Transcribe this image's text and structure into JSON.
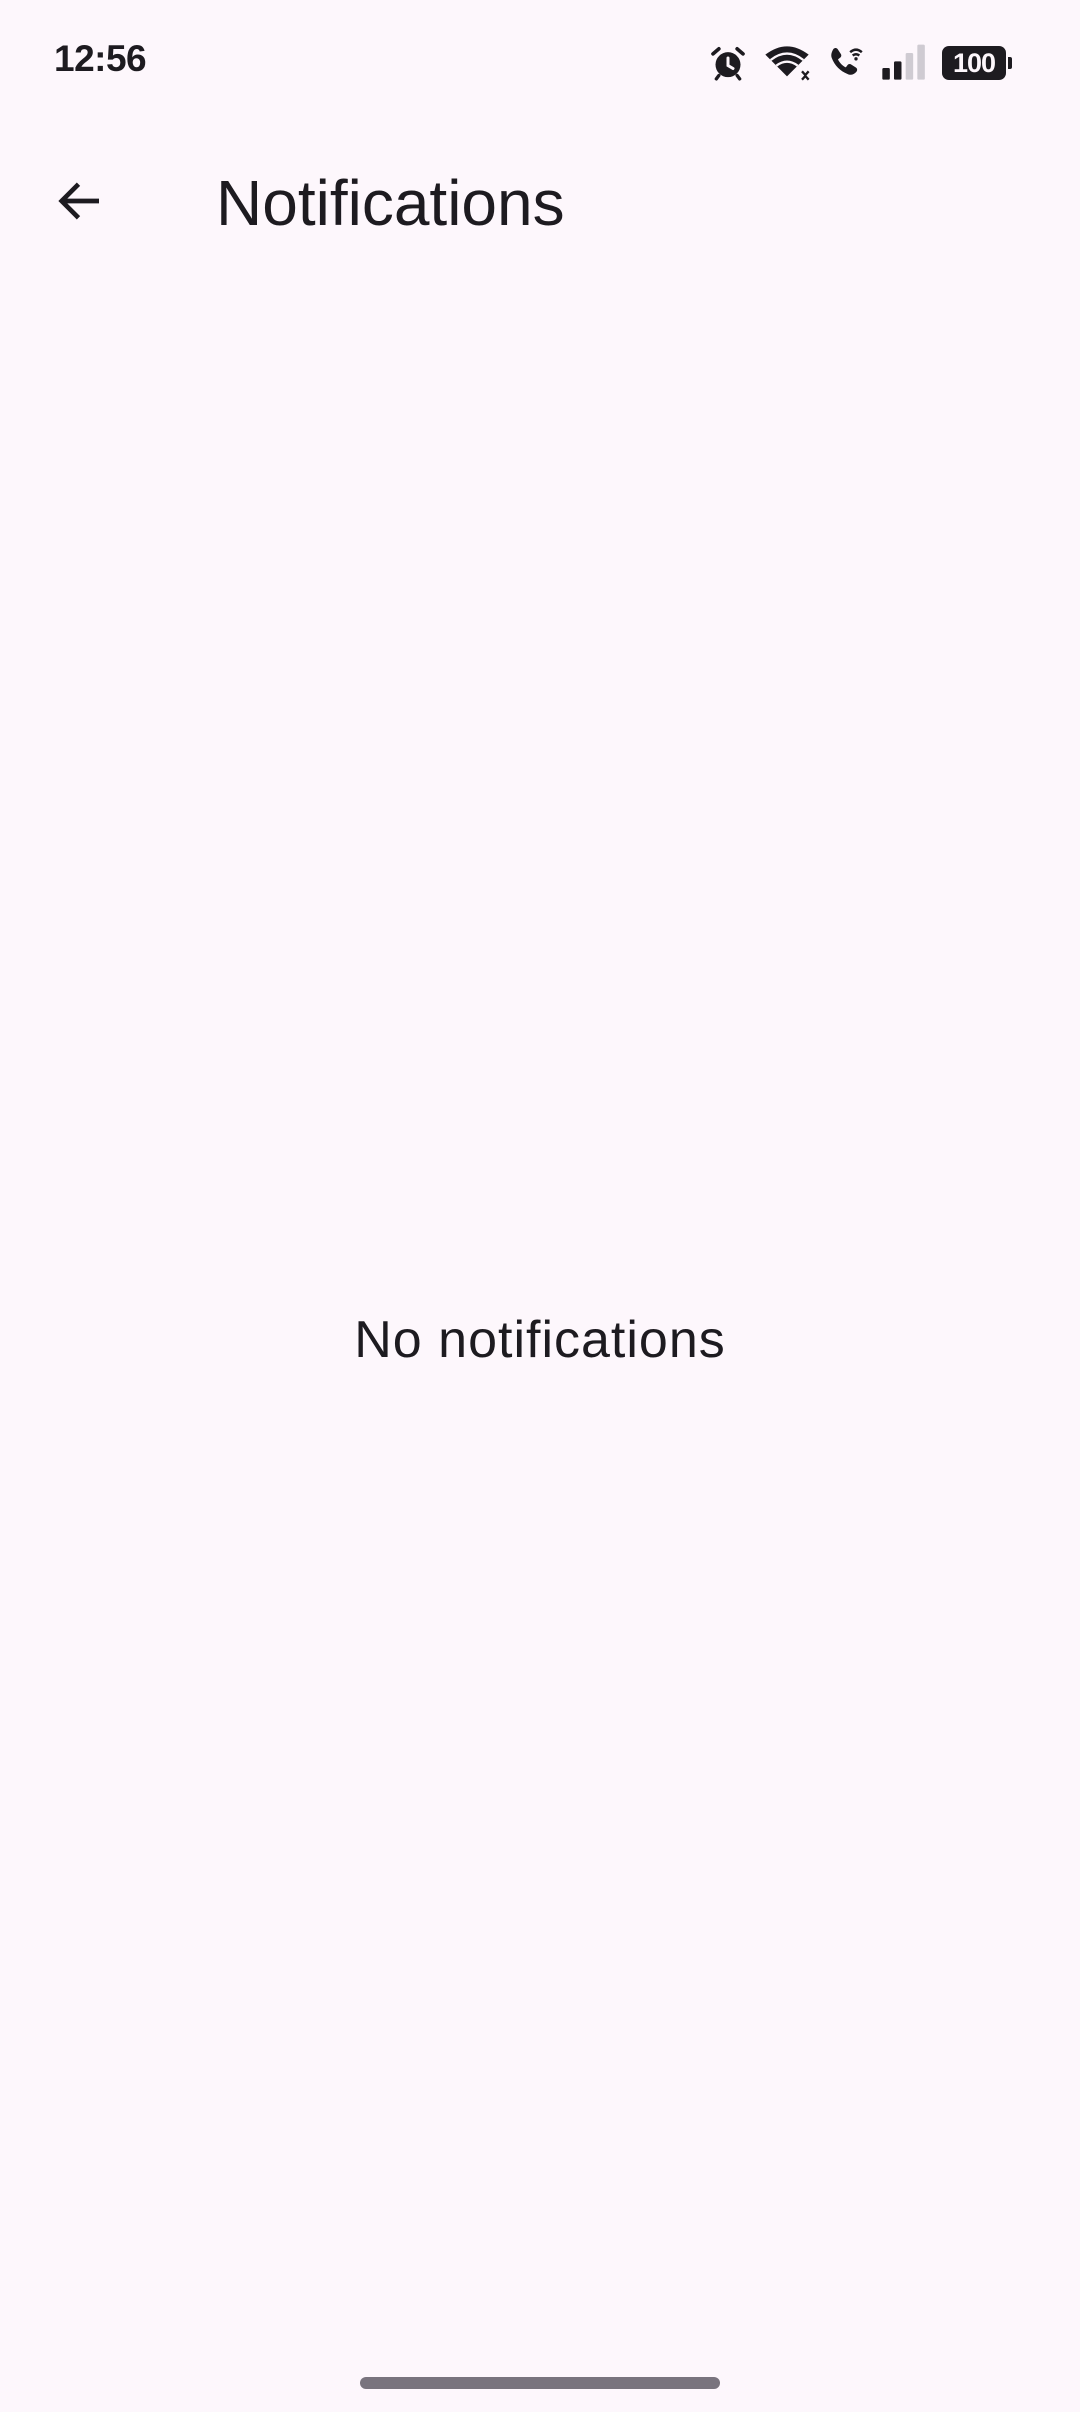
{
  "status_bar": {
    "time": "12:56",
    "battery": "100",
    "icons": [
      "alarm-icon",
      "wifi-icon",
      "wifi-calling-icon",
      "signal-icon",
      "battery-icon"
    ]
  },
  "app_bar": {
    "back_icon": "arrow-back-icon",
    "title": "Notifications"
  },
  "main": {
    "empty_message": "No notifications"
  },
  "colors": {
    "background": "#FDF7FC",
    "text": "#1D1B20",
    "home_indicator": "#79747E"
  }
}
